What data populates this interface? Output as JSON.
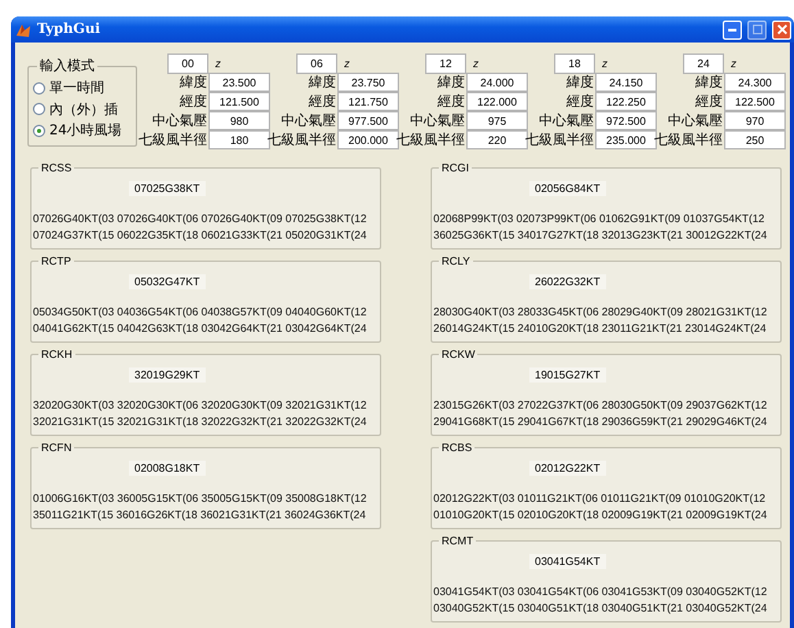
{
  "window": {
    "title": "TyphGui"
  },
  "input_mode": {
    "title": "輸入模式",
    "options": [
      {
        "label": "單一時間",
        "selected": false
      },
      {
        "label": "內（外）插",
        "selected": false
      },
      {
        "label": "24小時風場",
        "selected": true
      }
    ]
  },
  "time_columns": [
    {
      "hour": "00",
      "unit": "z",
      "rows": [
        {
          "label": "緯度",
          "value": "23.500"
        },
        {
          "label": "經度",
          "value": "121.500"
        },
        {
          "label": "中心氣壓",
          "value": "980"
        },
        {
          "label": "七級風半徑",
          "value": "180"
        }
      ]
    },
    {
      "hour": "06",
      "unit": "z",
      "rows": [
        {
          "label": "緯度",
          "value": "23.750"
        },
        {
          "label": "經度",
          "value": "121.750"
        },
        {
          "label": "中心氣壓",
          "value": "977.500"
        },
        {
          "label": "七級風半徑",
          "value": "200.000"
        }
      ]
    },
    {
      "hour": "12",
      "unit": "z",
      "rows": [
        {
          "label": "緯度",
          "value": "24.000"
        },
        {
          "label": "經度",
          "value": "122.000"
        },
        {
          "label": "中心氣壓",
          "value": "975"
        },
        {
          "label": "七級風半徑",
          "value": "220"
        }
      ]
    },
    {
      "hour": "18",
      "unit": "z",
      "rows": [
        {
          "label": "緯度",
          "value": "24.150"
        },
        {
          "label": "經度",
          "value": "122.250"
        },
        {
          "label": "中心氣壓",
          "value": "972.500"
        },
        {
          "label": "七級風半徑",
          "value": "235.000"
        }
      ]
    },
    {
      "hour": "24",
      "unit": "z",
      "rows": [
        {
          "label": "緯度",
          "value": "24.300"
        },
        {
          "label": "經度",
          "value": "122.500"
        },
        {
          "label": "中心氣壓",
          "value": "970"
        },
        {
          "label": "七級風半徑",
          "value": "250"
        }
      ]
    }
  ],
  "left_stations": [
    {
      "code": "RCSS",
      "current": "07025G38KT",
      "forecast": [
        "07026G40KT(03 07026G40KT(06 07026G40KT(09 07025G38KT(12",
        "07024G37KT(15 06022G35KT(18 06021G33KT(21 05020G31KT(24"
      ]
    },
    {
      "code": "RCTP",
      "current": "05032G47KT",
      "forecast": [
        "05034G50KT(03 04036G54KT(06 04038G57KT(09 04040G60KT(12",
        "04041G62KT(15 04042G63KT(18 03042G64KT(21 03042G64KT(24"
      ]
    },
    {
      "code": "RCKH",
      "current": "32019G29KT",
      "forecast": [
        "32020G30KT(03 32020G30KT(06 32020G30KT(09 32021G31KT(12",
        "32021G31KT(15 32021G31KT(18 32022G32KT(21 32022G32KT(24"
      ]
    },
    {
      "code": "RCFN",
      "current": "02008G18KT",
      "forecast": [
        "01006G16KT(03 36005G15KT(06 35005G15KT(09 35008G18KT(12",
        "35011G21KT(15 36016G26KT(18 36021G31KT(21 36024G36KT(24"
      ]
    }
  ],
  "right_stations": [
    {
      "code": "RCGI",
      "current": "02056G84KT",
      "forecast": [
        "02068P99KT(03 02073P99KT(06 01062G91KT(09 01037G54KT(12",
        "36025G36KT(15 34017G27KT(18 32013G23KT(21 30012G22KT(24"
      ]
    },
    {
      "code": "RCLY",
      "current": "26022G32KT",
      "forecast": [
        "28030G40KT(03 28033G45KT(06 28029G40KT(09 28021G31KT(12",
        "26014G24KT(15 24010G20KT(18 23011G21KT(21 23014G24KT(24"
      ]
    },
    {
      "code": "RCKW",
      "current": "19015G27KT",
      "forecast": [
        "23015G26KT(03 27022G37KT(06 28030G50KT(09 29037G62KT(12",
        "29041G68KT(15 29041G67KT(18 29036G59KT(21 29029G46KT(24"
      ]
    },
    {
      "code": "RCBS",
      "current": "02012G22KT",
      "forecast": [
        "02012G22KT(03 01011G21KT(06 01011G21KT(09 01010G20KT(12",
        "01010G20KT(15 02010G20KT(18 02009G19KT(21 02009G19KT(24"
      ]
    },
    {
      "code": "RCMT",
      "current": "03041G54KT",
      "forecast": [
        "03041G54KT(03 03041G54KT(06 03041G53KT(09 03040G52KT(12",
        "03040G52KT(15 03040G51KT(18 03040G51KT(21 03040G52KT(24"
      ]
    }
  ]
}
